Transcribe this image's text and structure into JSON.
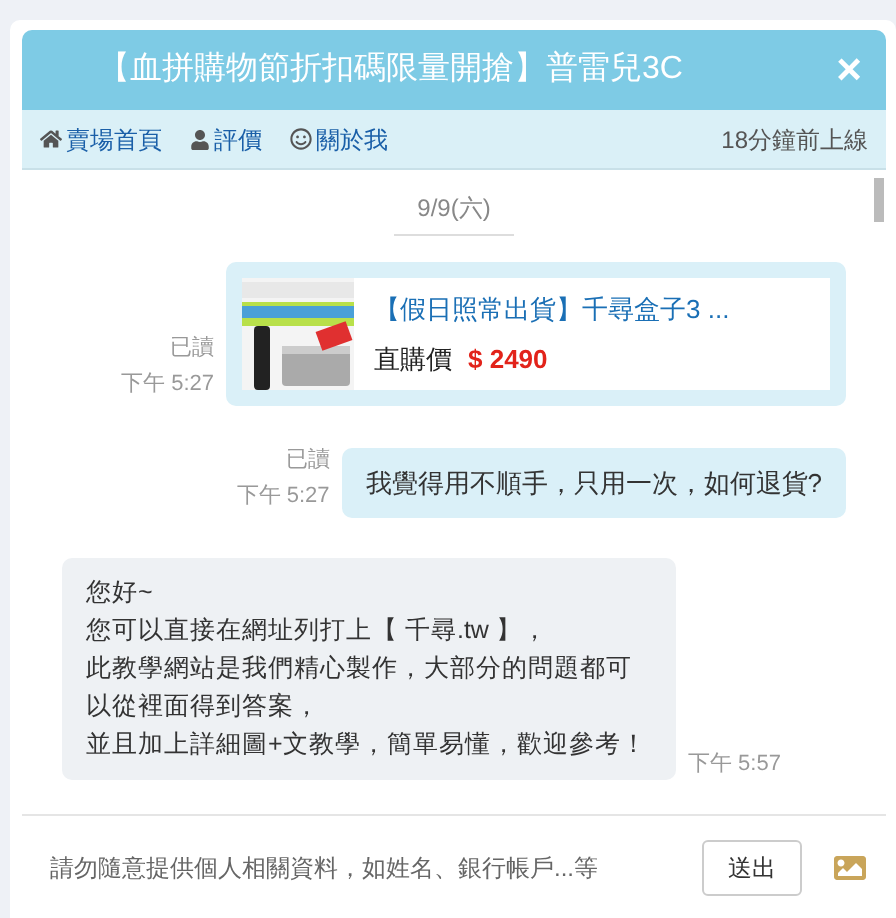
{
  "window": {
    "title": "【血拼購物節折扣碼限量開搶】普雷兒3C",
    "close": "×"
  },
  "nav": {
    "items": [
      {
        "kind": "home",
        "label": "賣場首頁"
      },
      {
        "kind": "user",
        "label": "評價"
      },
      {
        "kind": "smile",
        "label": "關於我"
      }
    ],
    "status": "18分鐘前上線"
  },
  "date": "9/9(六)",
  "messages": [
    {
      "kind": "product",
      "read": "已讀",
      "time": "下午 5:27",
      "product": {
        "title": "【假日照常出貨】千尋盒子3 ...",
        "price_label": "直購價",
        "price": "$ 2490"
      }
    },
    {
      "kind": "outgoing",
      "read": "已讀",
      "time": "下午 5:27",
      "text": "我覺得用不順手，只用一次，如何退貨?"
    },
    {
      "kind": "incoming",
      "time": "下午 5:57",
      "lines": [
        "您好~",
        "您可以直接在網址列打上【 千尋.tw 】，",
        "此教學網站是我們精心製作，大部分的問題都可",
        "以從裡面得到答案，",
        "並且加上詳細圖+文教學，簡單易懂，歡迎參考！"
      ]
    }
  ],
  "composer": {
    "placeholder": "請勿隨意提供個人相關資料，如姓名、銀行帳戶...等",
    "send": "送出"
  }
}
